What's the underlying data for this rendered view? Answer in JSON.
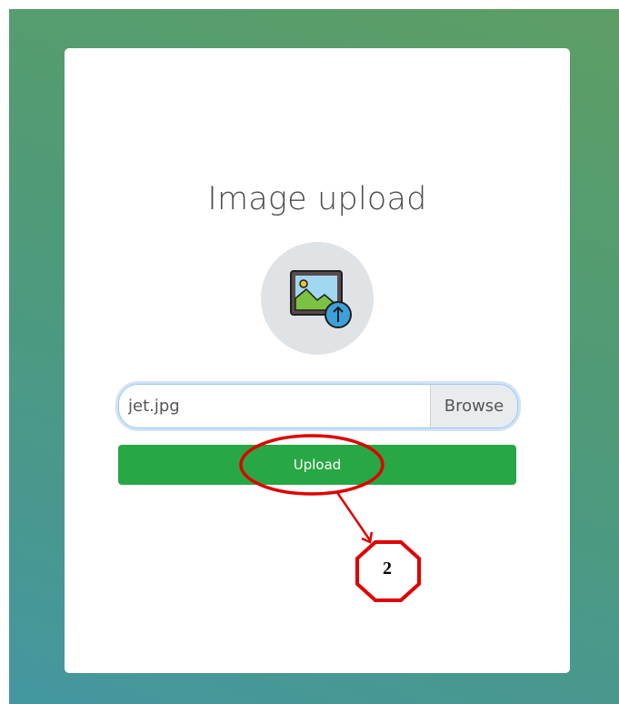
{
  "page": {
    "title": "Image upload"
  },
  "file_picker": {
    "value": "jet.jpg",
    "browse_label": "Browse"
  },
  "upload_button": {
    "label": "Upload"
  },
  "annotation": {
    "step_number": "2",
    "color": "#e00000"
  },
  "colors": {
    "accent": "#28a745",
    "icon_circle": "#dfe3e6"
  },
  "icons": {
    "main": "image-upload-icon"
  }
}
